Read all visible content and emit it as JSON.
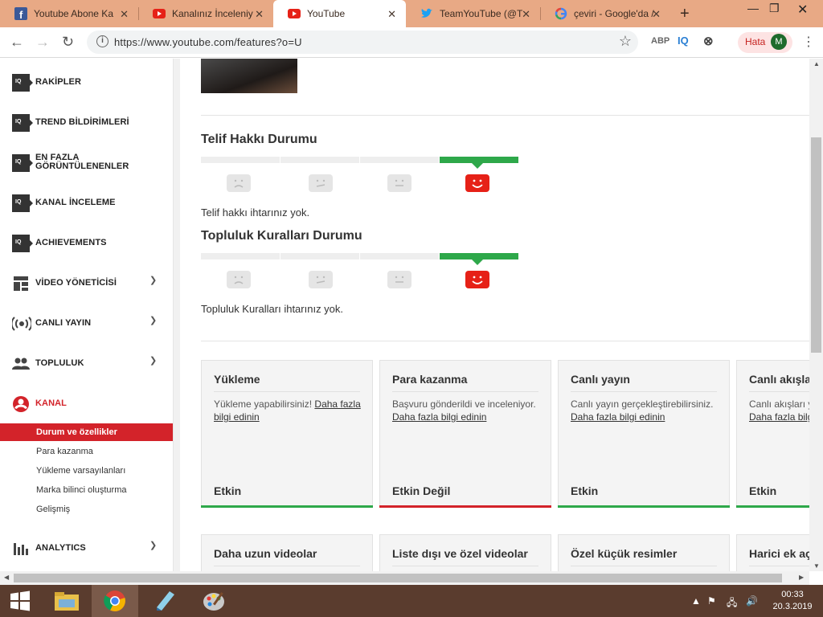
{
  "browser": {
    "tabs": [
      {
        "label": "Youtube Abone Ka",
        "icon": "facebook-icon",
        "active": false
      },
      {
        "label": "Kanalınız İnceleniy",
        "icon": "youtube-icon",
        "active": false
      },
      {
        "label": "YouTube",
        "icon": "youtube-icon",
        "active": true
      },
      {
        "label": "TeamYouTube (@T",
        "icon": "twitter-icon",
        "active": false
      },
      {
        "label": "çeviri - Google'da /",
        "icon": "google-icon",
        "active": false
      }
    ],
    "url": "https://www.youtube.com/features?o=U",
    "extensions": [
      "ABP",
      "IQ"
    ],
    "error_badge": "Hata",
    "profile_initial": "M"
  },
  "sidebar": {
    "items": [
      {
        "label": "RAKİPLER",
        "icon": "iq-icon"
      },
      {
        "label": "TREND BİLDİRİMLERİ",
        "icon": "iq-icon"
      },
      {
        "label_line1": "EN FAZLA",
        "label_line2": "GÖRÜNTÜLENENLER",
        "icon": "iq-icon"
      },
      {
        "label": "KANAL İNCELEME",
        "icon": "iq-icon"
      },
      {
        "label": "ACHIEVEMENTS",
        "icon": "iq-icon"
      },
      {
        "label": "VİDEO YÖNETİCİSİ",
        "icon": "video-manager-icon"
      },
      {
        "label": "CANLI YAYIN",
        "icon": "live-icon"
      },
      {
        "label": "TOPLULUK",
        "icon": "community-icon"
      },
      {
        "label": "KANAL",
        "icon": "channel-icon"
      }
    ],
    "sub_items": [
      "Durum ve özellikler",
      "Para kazanma",
      "Yükleme varsayılanları",
      "Marka bilinci oluşturma",
      "Gelişmiş"
    ],
    "analytics": "ANALYTICS"
  },
  "main": {
    "copyright": {
      "title": "Telif Hakkı Durumu",
      "message": "Telif hakkı ihtarınız yok."
    },
    "community": {
      "title": "Topluluk Kuralları Durumu",
      "message": "Topluluk Kuralları ihtarınız yok."
    },
    "features": [
      {
        "title": "Yükleme",
        "desc": "Yükleme yapabilirsiniz!",
        "link": "Daha fazla bilgi edinin",
        "status": "Etkin",
        "status_color": "#2ea84a"
      },
      {
        "title": "Para kazanma",
        "desc": "Başvuru gönderildi ve inceleniyor.",
        "link": "Daha fazla bilgi edinin",
        "status": "Etkin Değil",
        "status_color": "#d3232a"
      },
      {
        "title": "Canlı yayın",
        "desc": "Canlı yayın gerçekleştirebilirsiniz.",
        "link": "Daha fazla bilgi edinin",
        "status": "Etkin",
        "status_color": "#2ea84a"
      },
      {
        "title": "Canlı akışlar",
        "desc": "Canlı akışları y",
        "link": "Daha fazla bilgi",
        "status": "Etkin",
        "status_color": "#2ea84a"
      }
    ],
    "features_row2": [
      "Daha uzun videolar",
      "Liste dışı ve özel videolar",
      "Özel küçük resimler",
      "Harici ek aç"
    ]
  },
  "taskbar": {
    "time": "00:33",
    "date": "20.3.2019"
  },
  "colors": {
    "accent_red": "#d3232a",
    "status_green": "#2ea84a",
    "tabstrip": "#e8a985",
    "taskbar": "#5a3c2e"
  }
}
